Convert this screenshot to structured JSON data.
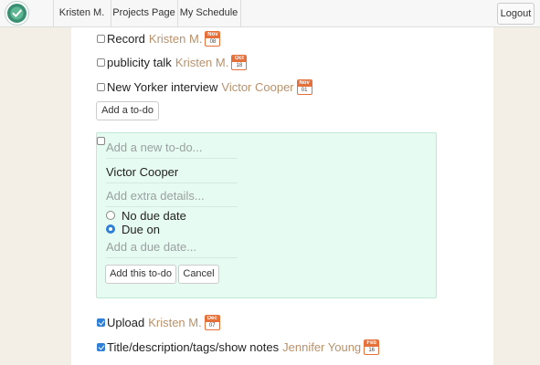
{
  "nav": {
    "items": [
      "Kristen M.",
      "Projects Page",
      "My Schedule"
    ],
    "logout_label": "Logout",
    "logo_icon": "check-circle-icon"
  },
  "todos_top": [
    {
      "title": "Record",
      "assignee": "Kristen M.",
      "due_month": "Nov",
      "due_day": "08",
      "checked": false
    },
    {
      "title": "publicity talk",
      "assignee": "Kristen M.",
      "due_month": "Oct",
      "due_day": "18",
      "checked": false
    },
    {
      "title": "New Yorker interview",
      "assignee": "Victor Cooper",
      "due_month": "Nov",
      "due_day": "01",
      "checked": false
    }
  ],
  "add_todo_label": "Add a to-do",
  "new_todo_form": {
    "title_placeholder": "Add a new to-do...",
    "assignee_value": "Victor Cooper",
    "details_placeholder": "Add extra details...",
    "radio_no_due": "No due date",
    "radio_due_on": "Due on",
    "selected": "due_on",
    "due_date_placeholder": "Add a due date...",
    "submit_label": "Add this to-do",
    "cancel_label": "Cancel"
  },
  "todos_done": [
    {
      "title": "Upload",
      "assignee": "Kristen M.",
      "due_month": "Dec",
      "due_day": "07",
      "checked": true
    },
    {
      "title": "Title/description/tags/show notes",
      "assignee": "Jennifer Young",
      "due_month": "Feb",
      "due_day": "16",
      "checked": true
    }
  ],
  "colors": {
    "accent": "#2f7fd6",
    "assignee": "#b9916a",
    "badge": "#e6703a",
    "form_bg": "#e6fbf2",
    "page_bg": "#f4efe6"
  }
}
